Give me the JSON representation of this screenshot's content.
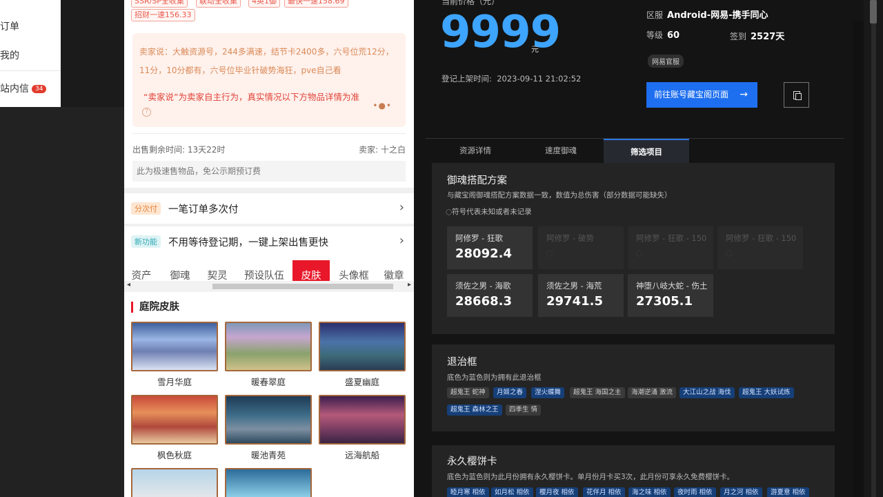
{
  "left_nav": {
    "orders": "订单",
    "mine": "我的",
    "messages": "站内信",
    "message_count": "34"
  },
  "listing": {
    "tags": [
      "SSR/SP全收集",
      "联动全收集",
      "4英1御",
      "最快一速158.69",
      "招财一速156.33"
    ],
    "seller_note": "卖家说：大触资源号，244多满速，结节卡2400多，六号位荒12分，11分，10分都有，六号位毕业针破势海狂，pve自己看",
    "seller_disclaimer": "“卖家说”为卖家自主行为，真实情况以下方物品详情为准",
    "remaining_time": "出售剩余时间: 13天22时",
    "seller": "卖家: 十之白",
    "fast_sale_note": "此为极速售物品，免公示期预订费",
    "installment_badge": "分次付",
    "installment_label": "一笔订单多次付",
    "new_feature_badge": "新功能",
    "new_feature_label": "不用等待登记期，一键上架出售更快",
    "category_tabs": [
      "资产",
      "御魂",
      "契灵",
      "预设队伍",
      "皮肤",
      "头像框",
      "徽章"
    ],
    "active_tab": "皮肤",
    "section_title": "庭院皮肤",
    "skins": [
      "雪月华庭",
      "暖春翠庭",
      "盛夏幽庭",
      "枫色秋庭",
      "暖池青苑",
      "远海航船"
    ]
  },
  "details": {
    "price_caption": "当前价格（元）",
    "price": "9999",
    "currency": "元",
    "register_time_label": "登记上架时间:",
    "register_time": "2023-09-11 21:02:52",
    "server_label": "区服",
    "server": "Android-网易-携手同心",
    "level_label": "等级",
    "level": "60",
    "signin_label": "签到",
    "signin": "2527天",
    "official_badge": "网易官服",
    "go_button": "前往账号藏宝阁页面",
    "tabs": [
      "资源详情",
      "速度御魂",
      "筛选项目"
    ],
    "active_tab": "筛选项目",
    "yuhun": {
      "title": "御魂搭配方案",
      "subtitle": "与藏宝阁御魂搭配方案数据一致，数值为总伤害（部分数据可能缺失）",
      "note": "◌符号代表未知或者未记录",
      "cells": [
        {
          "label": "阿修罗 - 狂歌",
          "value": "28092.4"
        },
        {
          "label": "阿修罗 - 破势",
          "value": "◌"
        },
        {
          "label": "阿修罗 - 狂歌 - 150",
          "value": "◌"
        },
        {
          "label": "阿修罗 - 狂歌 - 150",
          "value": "◌"
        },
        {
          "label": "须佐之男 - 海歌",
          "value": "28668.3"
        },
        {
          "label": "须佐之男 - 海荒",
          "value": "29741.5"
        },
        {
          "label": "神堕八岐大蛇 - 伤土",
          "value": "27305.1"
        }
      ]
    },
    "frames": {
      "title": "退治框",
      "subtitle": "底色为蓝色则为拥有此退治框",
      "chips": [
        {
          "text": "超鬼王 蛇神",
          "owned": false
        },
        {
          "text": "月姬之春",
          "owned": true
        },
        {
          "text": "涅火蝶舞",
          "owned": true
        },
        {
          "text": "超鬼王 海国之主",
          "owned": false
        },
        {
          "text": "海潮逆涌 激流",
          "owned": false
        },
        {
          "text": "大江山之战 海伐",
          "owned": true
        },
        {
          "text": "超鬼王 大妖试炼",
          "owned": true
        },
        {
          "text": "超鬼王 森林之王",
          "owned": true
        },
        {
          "text": "四季生 情",
          "owned": false
        }
      ]
    },
    "sakura": {
      "title": "永久樱饼卡",
      "subtitle": "底色为蓝色则为此月份拥有永久樱饼卡。单月份月卡买3次，此月份可享永久免费樱饼卡。",
      "chips": [
        {
          "text": "睦月寒 相依",
          "owned": true
        },
        {
          "text": "如月松 相依",
          "owned": true
        },
        {
          "text": "樱月夜 相依",
          "owned": true
        },
        {
          "text": "花伴月 相依",
          "owned": true
        },
        {
          "text": "海之味 相依",
          "owned": true
        },
        {
          "text": "夜时雨 相依",
          "owned": true
        },
        {
          "text": "月之河 相依",
          "owned": true
        },
        {
          "text": "游夏意 相依",
          "owned": true
        }
      ]
    }
  }
}
